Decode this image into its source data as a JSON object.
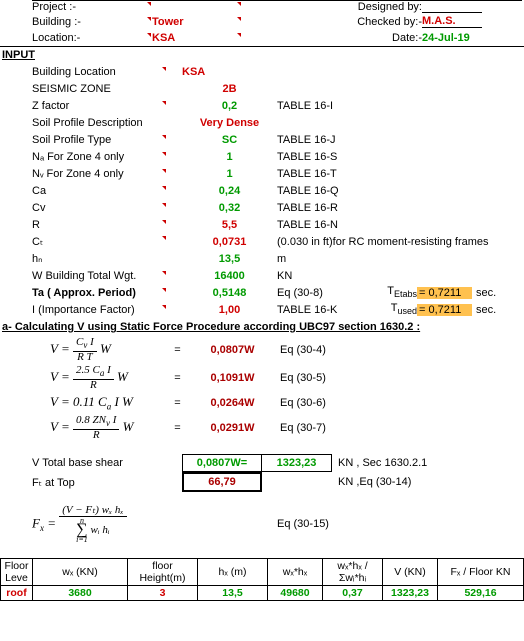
{
  "header": {
    "project_label": "Project :-",
    "building_label": "Building :-",
    "building_val": "Tower",
    "location_label": "Location:-",
    "location_val": "KSA",
    "designed_label": "Designed by:",
    "checked_label": "Checked by:-",
    "checked_val": "M.A.S.",
    "date_label": "Date:-",
    "date_val": "24-Jul-19"
  },
  "input_title": "INPUT",
  "inputs": {
    "building_location": {
      "label": "Building Location",
      "val": "KSA"
    },
    "seismic_zone": {
      "label": "SEISMIC ZONE",
      "val": "2B"
    },
    "z_factor": {
      "label": "Z factor",
      "val": "0,2",
      "ref": "TABLE 16-I"
    },
    "soil_desc": {
      "label": "Soil Profile Description",
      "val": "Very Dense"
    },
    "soil_type": {
      "label": "Soil Profile Type",
      "val": "SC",
      "ref": "TABLE 16-J"
    },
    "na": {
      "label": "Nₐ For Zone 4 only",
      "val": "1",
      "ref": "TABLE 16-S"
    },
    "nv": {
      "label": "Nᵥ For Zone 4 only",
      "val": "1",
      "ref": "TABLE 16-T"
    },
    "ca": {
      "label": "Ca",
      "val": "0,24",
      "ref": "TABLE 16-Q"
    },
    "cv": {
      "label": "Cv",
      "val": "0,32",
      "ref": "TABLE 16-R"
    },
    "r": {
      "label": "R",
      "val": "5,5",
      "ref": "TABLE 16-N"
    },
    "ct": {
      "label": "Cₜ",
      "val": "0,0731",
      "ref": "(0.030 in ft)for RC moment-resisting frames"
    },
    "hn": {
      "label": "hₙ",
      "val": "13,5",
      "ref": "m"
    },
    "w": {
      "label": "W Building Total Wgt.",
      "val": "16400",
      "ref": "KN"
    },
    "ta": {
      "label": "Ta  ( Approx. Period)",
      "val": "0,5148",
      "ref": "Eq (30-8)",
      "extra_label": "T_Etabs",
      "extra_val": "= 0,7211",
      "extra_unit": "sec."
    },
    "i": {
      "label": "I (Importance Factor)",
      "val": "1,00",
      "ref": "TABLE 16-K",
      "extra_label": "T_used",
      "extra_val": "= 0,7211",
      "extra_unit": "sec."
    }
  },
  "section_a": "a- Calculating V using Static Force Procedure according UBC97 section  1630.2 :",
  "eqs": [
    {
      "formula": "V = (Cᵥ I)/(R T) · W",
      "eq": "=",
      "val": "0,0807W",
      "ref": "Eq (30-4)"
    },
    {
      "formula": "V = (2.5 Cₐ I)/R · W",
      "eq": "=",
      "val": "0,1091W",
      "ref": "Eq (30-5)"
    },
    {
      "formula": "V = 0.11 Cₐ I W",
      "eq": "=",
      "val": "0,0264W",
      "ref": "Eq (30-6)"
    },
    {
      "formula": "V = (0.8 ZNᵥ I)/R · W",
      "eq": "=",
      "val": "0,0291W",
      "ref": "Eq (30-7)"
    }
  ],
  "vtotal": {
    "label": "V Total base shear",
    "coeff": "0,0807W=",
    "val": "1323,23",
    "note": "KN , Sec 1630.2.1"
  },
  "ft": {
    "label": "Fₜ  at Top",
    "val": "66,79",
    "note": "KN ,Eq (30-14)"
  },
  "fx": {
    "formula_label": "Fₓ =",
    "ref": "Eq (30-15)",
    "num": "(V − Fₜ) wₓ hₓ",
    "den_sum_top": "n",
    "den_sum_bot": "i=1",
    "den_body": "wᵢ hᵢ"
  },
  "table": {
    "headers": [
      "Floor Leve",
      "wₓ (KN)",
      "floor Height(m)",
      "hₓ (m)",
      "wₓ*hₓ",
      "wₓ*hₓ /Σwᵢ*hᵢ",
      "V (KN)",
      "Fₓ / Floor KN"
    ],
    "row1": [
      "roof",
      "3680",
      "3",
      "13,5",
      "49680",
      "0,37",
      "1323,23",
      "529,16"
    ]
  },
  "chart_data": {
    "type": "table",
    "title": "UBC97 Static Force Procedure Calculation",
    "inputs": {
      "Building Location": "KSA",
      "SEISMIC ZONE": "2B",
      "Z factor": 0.2,
      "Soil Profile Description": "Very Dense",
      "Soil Profile Type": "SC",
      "Na": 1,
      "Nv": 1,
      "Ca": 0.24,
      "Cv": 0.32,
      "R": 5.5,
      "Ct": 0.0731,
      "hn_m": 13.5,
      "W_kN": 16400,
      "Ta_sec": 0.5148,
      "I": 1.0,
      "T_Etabs_sec": 0.7211,
      "T_used_sec": 0.7211
    },
    "V_coefficients": {
      "Eq(30-4)": 0.0807,
      "Eq(30-5)": 0.1091,
      "Eq(30-6)": 0.0264,
      "Eq(30-7)": 0.0291
    },
    "V_total_base_shear_kN": 1323.23,
    "Ft_at_top_kN": 66.79,
    "floor_table": {
      "columns": [
        "Floor",
        "wx_kN",
        "floor_height_m",
        "hx_m",
        "wx*hx",
        "wx*hx/Sum",
        "V_kN",
        "Fx_kN"
      ],
      "rows": [
        [
          "roof",
          3680,
          3,
          13.5,
          49680,
          0.37,
          1323.23,
          529.16
        ]
      ]
    }
  }
}
